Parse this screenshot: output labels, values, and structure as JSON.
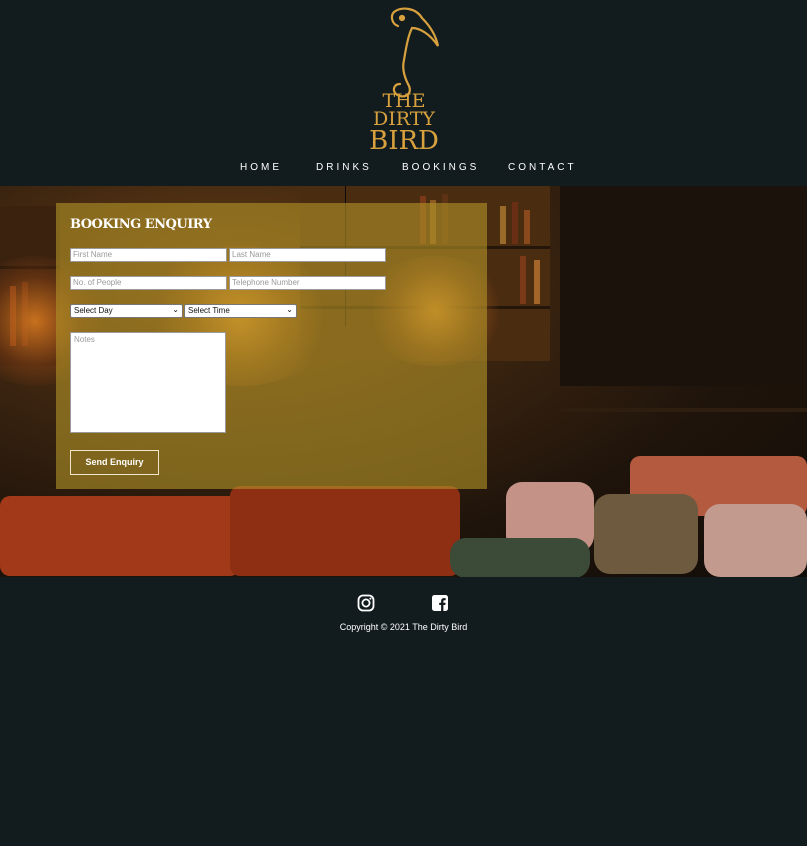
{
  "brand": {
    "logo_line1": "THE",
    "logo_line2": "DIRTY",
    "logo_line3": "BIRD",
    "logo_color": "#d8a13e",
    "icon": "flamingo-logo-icon"
  },
  "nav": {
    "items": [
      {
        "label": "HOME"
      },
      {
        "label": "DRINKS"
      },
      {
        "label": "BOOKINGS"
      },
      {
        "label": "CONTACT"
      }
    ]
  },
  "hero": {
    "background": "bar-interior-photo"
  },
  "booking": {
    "title": "BOOKING ENQUIRY",
    "first_name_placeholder": "First Name",
    "last_name_placeholder": "Last Name",
    "people_placeholder": "No. of People",
    "phone_placeholder": "Telephone Number",
    "day_select": "Select Day",
    "time_select": "Select Time",
    "notes_placeholder": "Notes",
    "submit_label": "Send Enquiry",
    "panel_color": "#b09226"
  },
  "footer": {
    "icons": [
      "instagram-icon",
      "facebook-icon"
    ],
    "copyright": "Copyright © 2021 The Dirty Bird"
  },
  "colors": {
    "page_bg": "#121c1f",
    "accent": "#d8a13e"
  }
}
